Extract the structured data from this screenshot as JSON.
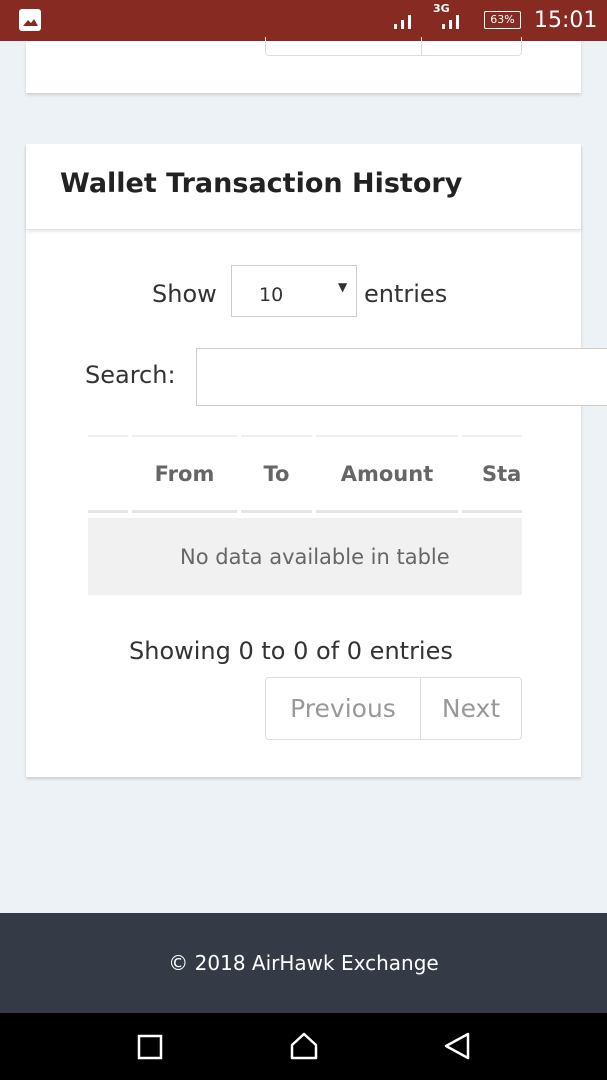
{
  "statusbar": {
    "network": "3G",
    "battery": "63%",
    "time": "15:01"
  },
  "card": {
    "title": "Wallet Transaction History"
  },
  "length": {
    "show": "Show",
    "value": "10",
    "entries": "entries"
  },
  "search": {
    "label": "Search:",
    "value": ""
  },
  "table": {
    "headers": [
      "",
      "From",
      "To",
      "Amount",
      "Sta"
    ],
    "empty": "No data available in table"
  },
  "info": "Showing 0 to 0 of 0 entries",
  "pagination": {
    "previous": "Previous",
    "next": "Next"
  },
  "footer": "© 2018 AirHawk Exchange"
}
